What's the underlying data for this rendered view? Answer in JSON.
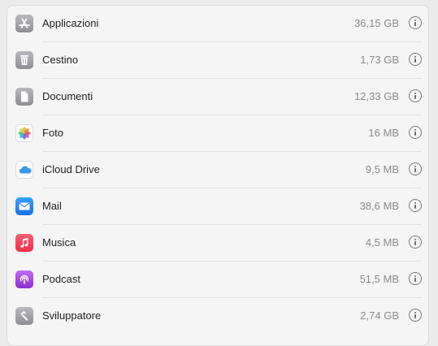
{
  "storage_list": {
    "items": [
      {
        "label": "Applicazioni",
        "size": "36,15 GB",
        "icon": "app-store-icon"
      },
      {
        "label": "Cestino",
        "size": "1,73 GB",
        "icon": "trash-icon"
      },
      {
        "label": "Documenti",
        "size": "12,33 GB",
        "icon": "document-icon"
      },
      {
        "label": "Foto",
        "size": "16 MB",
        "icon": "photos-icon"
      },
      {
        "label": "iCloud Drive",
        "size": "9,5 MB",
        "icon": "icloud-icon"
      },
      {
        "label": "Mail",
        "size": "38,6 MB",
        "icon": "mail-icon"
      },
      {
        "label": "Musica",
        "size": "4,5 MB",
        "icon": "music-icon"
      },
      {
        "label": "Podcast",
        "size": "51,5 MB",
        "icon": "podcast-icon"
      },
      {
        "label": "Sviluppatore",
        "size": "2,74 GB",
        "icon": "hammer-icon"
      }
    ]
  },
  "colors": {
    "panel_background": "#f5f5f5",
    "label_text": "#222222",
    "size_text": "#8a8a8a",
    "divider": "#e0e0e0"
  }
}
